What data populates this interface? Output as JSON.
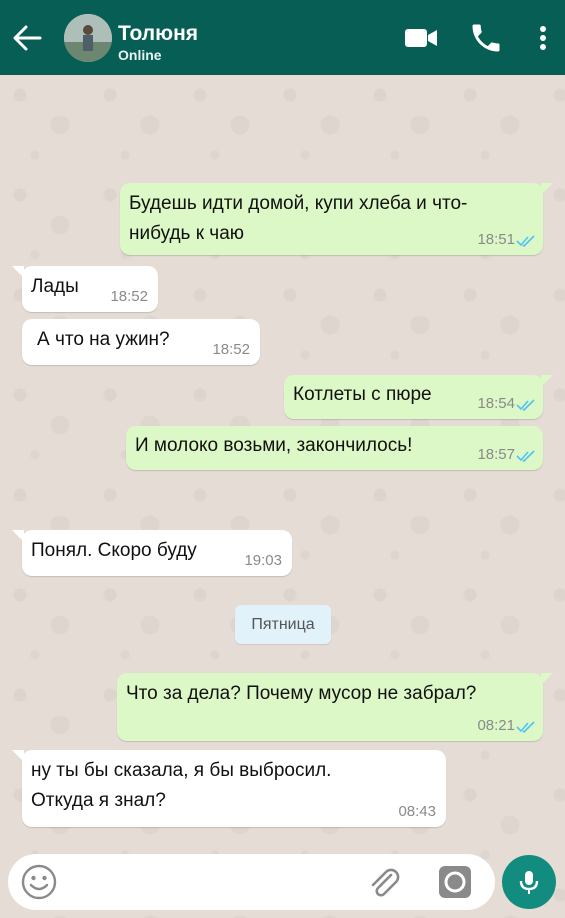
{
  "header": {
    "contact_name": "Толюня",
    "status": "Online",
    "icons": [
      "back-arrow-icon",
      "video-camera-icon",
      "phone-icon",
      "more-vertical-icon"
    ]
  },
  "messages": [
    {
      "dir": "out",
      "text": "Будешь идти домой, купи хлеба и что-\nнибудь к чаю",
      "time": "18:51"
    },
    {
      "dir": "in",
      "text": "Лады",
      "time": "18:52"
    },
    {
      "dir": "in",
      "text": "А что на ужин?",
      "time": "18:52"
    },
    {
      "dir": "out",
      "text": "Котлеты с пюре",
      "time": "18:54"
    },
    {
      "dir": "out",
      "text": "И молоко возьми, закончилось!",
      "time": "18:57"
    },
    {
      "dir": "in",
      "text": "Понял. Скоро буду",
      "time": "19:03"
    },
    {
      "dir": "out",
      "text": "Что за дела? Почему мусор не забрал?",
      "time": "08:21"
    },
    {
      "dir": "in",
      "text": "ну ты бы сказала, я бы выбросил.\nОткуда я знал?",
      "time": "08:43"
    }
  ],
  "day_separator": "Пятница",
  "composer": {
    "placeholder": "",
    "icons": [
      "emoji-icon",
      "paperclip-icon",
      "camera-icon",
      "microphone-icon"
    ]
  },
  "colors": {
    "header": "#075e54",
    "outgoing_bubble": "#dcf8c6",
    "incoming_bubble": "#ffffff",
    "read_ticks": "#4fc3f7",
    "mic_button": "#128c7e"
  }
}
